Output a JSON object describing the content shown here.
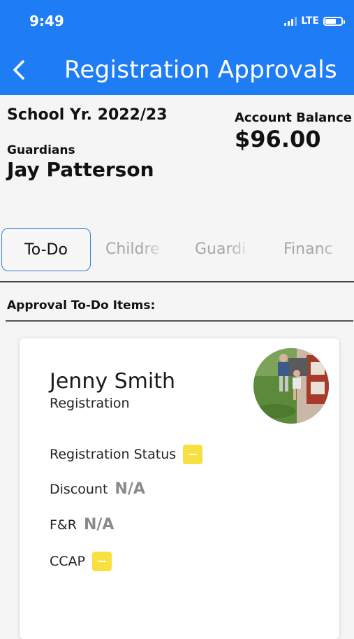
{
  "status_bar": {
    "time": "9:49",
    "network": "LTE"
  },
  "header": {
    "title": "Registration Approvals",
    "back_icon": "chevron-left-icon"
  },
  "summary": {
    "school_year": "School Yr. 2022/23",
    "guardians_label": "Guardians",
    "guardian_name": "Jay Patterson",
    "balance_label": "Account Balance",
    "balance_value": "$96.00"
  },
  "tabs": [
    {
      "label": "To-Do"
    },
    {
      "label": "Childre"
    },
    {
      "label": "Guardi"
    },
    {
      "label": "Financ"
    }
  ],
  "section": {
    "title": "Approval To-Do Items:"
  },
  "card": {
    "name": "Jenny Smith",
    "type": "Registration",
    "rows": [
      {
        "label": "Registration Status",
        "status": "pending"
      },
      {
        "label": "Discount",
        "value": "N/A"
      },
      {
        "label": "F&R",
        "value": "N/A"
      },
      {
        "label": "CCAP",
        "status": "pending"
      }
    ]
  },
  "colors": {
    "header": "#1e7cf5",
    "pending_badge": "#f7e040",
    "active_tab_border": "#3a7bd5"
  }
}
